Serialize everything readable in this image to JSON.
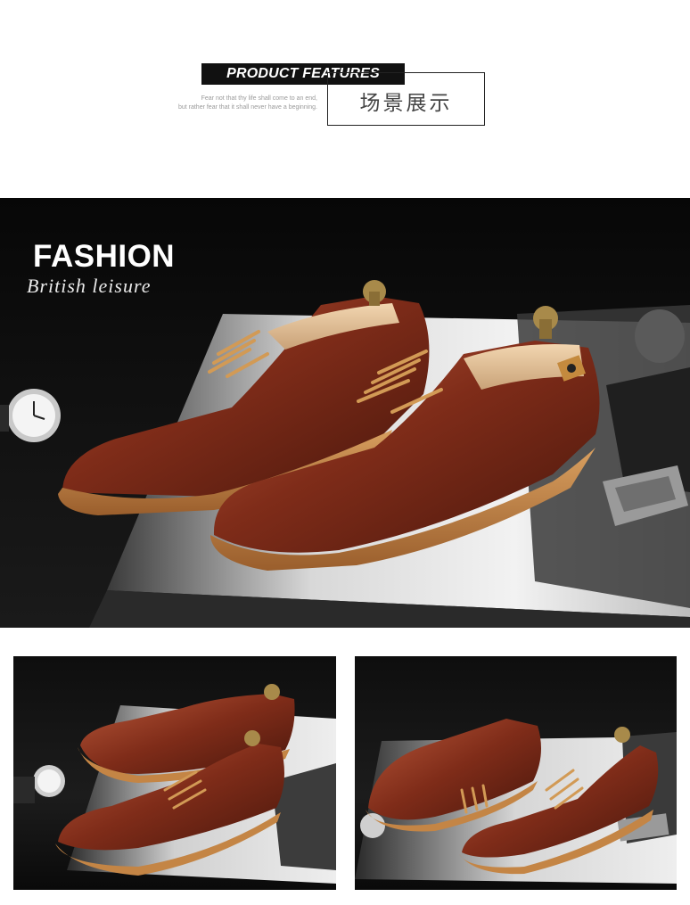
{
  "header": {
    "features_label": "PRODUCT FEATURES",
    "scene_title": "场景展示",
    "quote_line1": "Fear not that thy life shall come to an end,",
    "quote_line2": "but rather fear that it shall never have a beginning."
  },
  "hero": {
    "title": "FASHION",
    "subtitle": "British leisure"
  },
  "colors": {
    "leather": "#7a2a18",
    "leather_highlight": "#b5553a",
    "sole": "#c98a4a",
    "background": "#0d0d0d",
    "magazine": "#e8e8e8"
  },
  "images": [
    {
      "name": "hero-shoes-photo"
    },
    {
      "name": "shoes-pair-left-photo"
    },
    {
      "name": "shoes-pair-right-photo"
    }
  ]
}
